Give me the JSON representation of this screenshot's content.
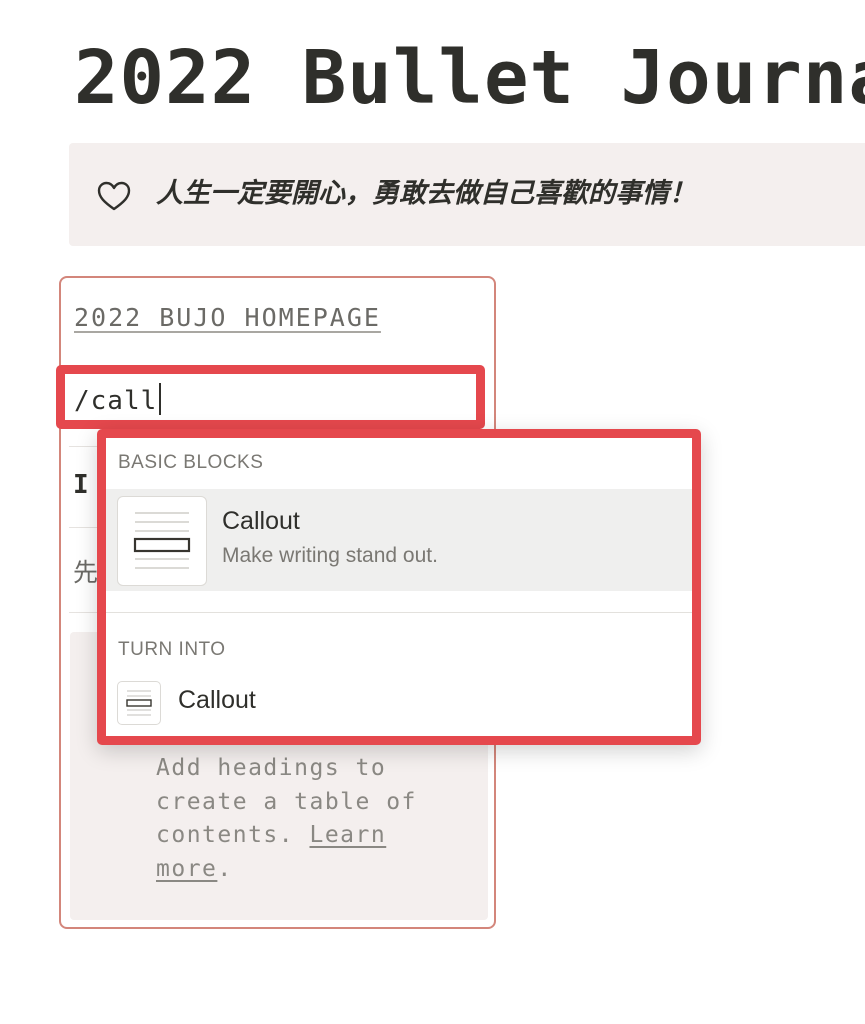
{
  "page": {
    "title": "2022 Bullet Journa"
  },
  "banner": {
    "icon": "heart-outline-icon",
    "text": "人生一定要開心，勇敢去做自己喜歡的事情！"
  },
  "card": {
    "heading": "2022 BUJO HOMEPAGE",
    "slash_command": "/call",
    "partial_letter": "I",
    "partial_cjk": "先",
    "toc_empty": {
      "text": "Add headings to create a table of contents.",
      "link_label": "Learn more",
      "suffix": "."
    }
  },
  "slash_menu": {
    "sections": [
      {
        "label": "BASIC BLOCKS",
        "items": [
          {
            "title": "Callout",
            "description": "Make writing stand out.",
            "icon": "callout-block-icon"
          }
        ]
      },
      {
        "label": "TURN INTO",
        "items": [
          {
            "title": "Callout",
            "icon": "callout-block-icon"
          }
        ]
      }
    ]
  },
  "colors": {
    "highlight_red": "#e5484d",
    "card_border": "#d3867b",
    "callout_bg": "#f4efee",
    "menu_hover": "#efefee"
  }
}
